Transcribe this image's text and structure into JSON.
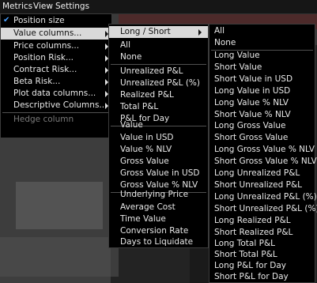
{
  "menubar": {
    "items": [
      {
        "label": "Metrics"
      },
      {
        "label": "View"
      },
      {
        "label": "Settings"
      }
    ]
  },
  "metrics_menu": {
    "items": [
      {
        "label": "Position size",
        "checked": true
      },
      {
        "label": "Value columns...",
        "submenu": true,
        "selected": true
      },
      {
        "label": "Price columns...",
        "submenu": true
      },
      {
        "label": "Position Risk...",
        "submenu": true
      },
      {
        "label": "Contract Risk...",
        "submenu": true
      },
      {
        "label": "Beta Risk...",
        "submenu": true
      },
      {
        "label": "Plot data columns...",
        "submenu": true
      },
      {
        "label": "Descriptive Columns...",
        "submenu": true
      },
      {
        "label": "Hedge column",
        "disabled": true
      }
    ]
  },
  "value_columns_menu": {
    "items": [
      {
        "label": "Long / Short",
        "submenu": true,
        "selected": true
      },
      {
        "label": "All"
      },
      {
        "label": "None"
      },
      {
        "label": "Unrealized P&L"
      },
      {
        "label": "Unrealized P&L (%)"
      },
      {
        "label": "Realized P&L"
      },
      {
        "label": "Total P&L"
      },
      {
        "label": "P&L for Day"
      },
      {
        "label": "Value"
      },
      {
        "label": "Value in USD"
      },
      {
        "label": "Value % NLV"
      },
      {
        "label": "Gross Value"
      },
      {
        "label": "Gross Value in USD"
      },
      {
        "label": "Gross Value % NLV"
      },
      {
        "label": "Underlying Price"
      },
      {
        "label": "Average Cost"
      },
      {
        "label": "Time Value"
      },
      {
        "label": "Conversion Rate"
      },
      {
        "label": "Days to Liquidate"
      }
    ]
  },
  "long_short_menu": {
    "items": [
      {
        "label": "All"
      },
      {
        "label": "None"
      },
      {
        "label": "Long Value"
      },
      {
        "label": "Short Value"
      },
      {
        "label": "Short Value in USD"
      },
      {
        "label": "Long Value in USD"
      },
      {
        "label": "Long Value % NLV"
      },
      {
        "label": "Short Value % NLV"
      },
      {
        "label": "Long Gross Value"
      },
      {
        "label": "Short Gross Value"
      },
      {
        "label": "Long Gross Value % NLV"
      },
      {
        "label": "Short Gross Value % NLV"
      },
      {
        "label": "Long Unrealized P&L"
      },
      {
        "label": "Short Unrealized P&L"
      },
      {
        "label": "Long Unrealized P&L (%)"
      },
      {
        "label": "Short Unrealized P&L (%)"
      },
      {
        "label": "Long Realized P&L"
      },
      {
        "label": "Short Realized P&L"
      },
      {
        "label": "Long Total P&L"
      },
      {
        "label": "Short Total P&L"
      },
      {
        "label": "Long P&L for Day"
      },
      {
        "label": "Short P&L for Day"
      }
    ]
  },
  "colors": {
    "selected_bg": "#d9d9d9",
    "check": "#4aa0ff",
    "menu_bg": "#000000"
  }
}
